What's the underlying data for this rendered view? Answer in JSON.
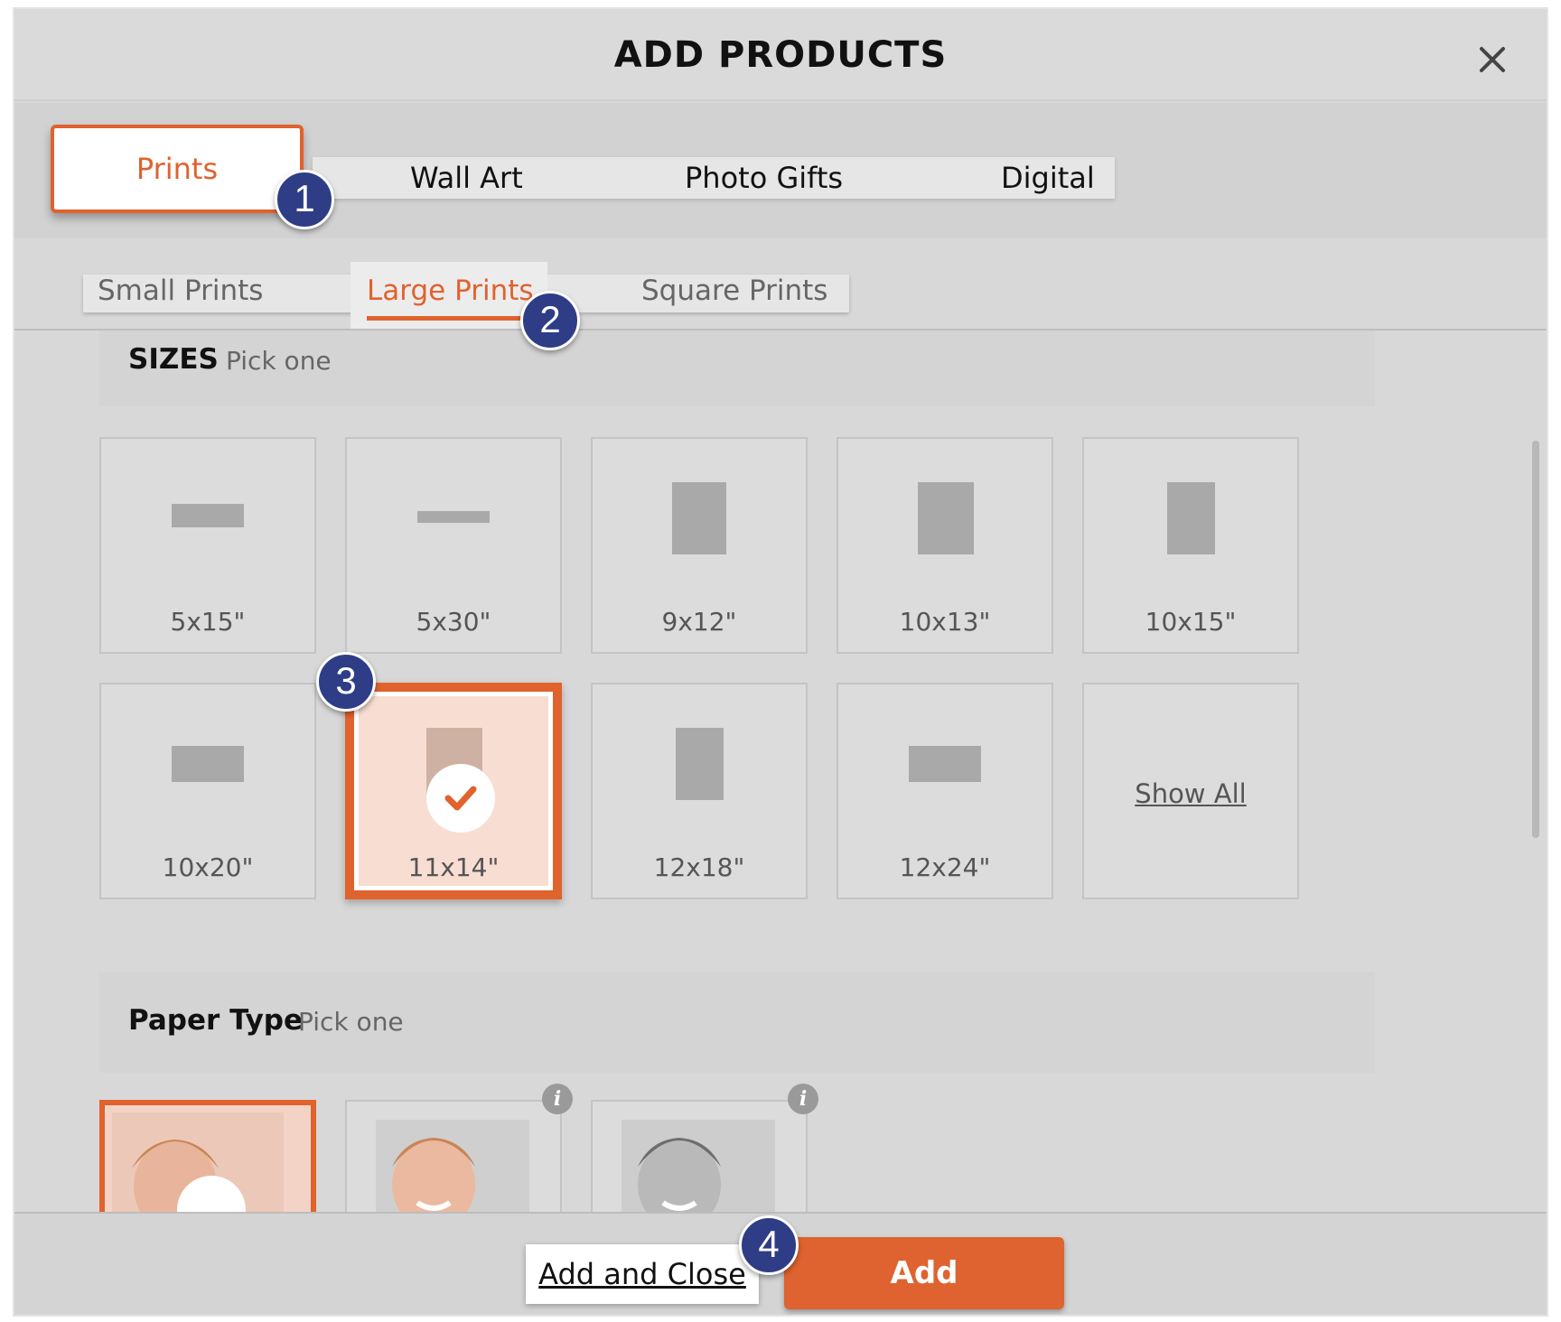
{
  "modal": {
    "title": "ADD PRODUCTS",
    "close_icon": "close-icon"
  },
  "categories": {
    "active": "Prints",
    "items": [
      "Prints",
      "Wall Art",
      "Photo Gifts",
      "Digital"
    ]
  },
  "subcategories": {
    "active": "Large Prints",
    "items": [
      "Small Prints",
      "Large Prints",
      "Square Prints"
    ]
  },
  "sizes": {
    "title": "SIZES",
    "hint": "Pick one",
    "selected": "11x14\"",
    "items": [
      "5x15\"",
      "5x30\"",
      "9x12\"",
      "10x13\"",
      "10x15\"",
      "10x20\"",
      "11x14\"",
      "12x18\"",
      "12x24\""
    ],
    "show_all_label": "Show All"
  },
  "paper_type": {
    "title": "Paper Type",
    "hint": "Pick one",
    "info_icon": "info-icon"
  },
  "footer": {
    "add_and_close_label": "Add and Close",
    "add_label": "Add"
  },
  "annotations": [
    "1",
    "2",
    "3",
    "4"
  ],
  "colors": {
    "accent": "#e0622d",
    "marker": "#2e3d86",
    "selected_tile_bg": "#f8ddd2"
  }
}
